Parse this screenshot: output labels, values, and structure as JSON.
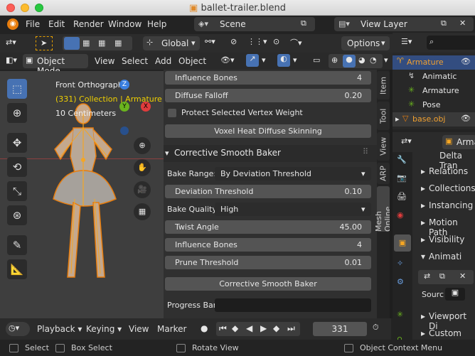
{
  "window": {
    "title": "ballet-trailer.blend"
  },
  "menubar": {
    "items": [
      "File",
      "Edit",
      "Render",
      "Window",
      "Help"
    ],
    "scene": "Scene",
    "view_layer": "View Layer"
  },
  "viewport_header": {
    "transform_orientation": "Global",
    "options_label": "Options",
    "mode": "Object Mode",
    "menus": [
      "View",
      "Select",
      "Add",
      "Object"
    ]
  },
  "viewport": {
    "view_name": "Front Orthographic",
    "collection": "(331) Collection | Armature",
    "scale": "10 Centimeters",
    "gizmo": {
      "z": "Z",
      "y": "Y",
      "x": "X"
    }
  },
  "panel": {
    "rows_top": [
      {
        "label": "Influence Bones",
        "value": "4"
      },
      {
        "label": "Diffuse Falloff",
        "value": "0.20"
      }
    ],
    "protect_checkbox": {
      "label": "Protect Selected Vertex Weight",
      "checked": false
    },
    "voxel_button": "Voxel Heat Diffuse Skinning",
    "section_title": "Corrective Smooth Baker",
    "bake_range": {
      "label": "Bake Range:",
      "value": "By Deviation Threshold"
    },
    "deviation": {
      "label": "Deviation Threshold",
      "value": "0.10"
    },
    "bake_quality": {
      "label": "Bake Quality:",
      "value": "High"
    },
    "rows_bottom": [
      {
        "label": "Twist Angle",
        "value": "45.00"
      },
      {
        "label": "Influence Bones",
        "value": "4"
      },
      {
        "label": "Prune Threshold",
        "value": "0.01"
      }
    ],
    "bake_button": "Corrective Smooth Baker",
    "progress_label": "Progress Bar:",
    "tabs": [
      "Item",
      "Tool",
      "View",
      "ARP",
      "Mesh Online"
    ]
  },
  "outliner": {
    "items": [
      {
        "label": "Armature",
        "selected": true
      },
      {
        "label": "Animatic"
      },
      {
        "label": "Armature"
      },
      {
        "label": "Pose"
      },
      {
        "label": "base.obj",
        "highlight": true
      }
    ]
  },
  "properties": {
    "object_name": "Armatu",
    "items": [
      "Delta Tran",
      "Relations",
      "Collections",
      "Instancing",
      "Motion Path",
      "Visibility",
      "Animati"
    ],
    "source_label": "Sourc",
    "bottom_items": [
      "Viewport Di",
      "Custom Pro"
    ]
  },
  "timeline": {
    "menus": [
      "Playback",
      "Keying",
      "View",
      "Marker"
    ],
    "current_frame": "331"
  },
  "statusbar": {
    "items": [
      "Select",
      "Box Select",
      "Rotate View",
      "Object Context Menu"
    ]
  },
  "colors": {
    "accent_orange": "#f5a623",
    "select_blue": "#4772b3",
    "highlight_orange": "#e87d0d",
    "axis_x": "#e03c3c",
    "axis_y": "#6ab31e",
    "axis_z": "#3a7fe0"
  }
}
